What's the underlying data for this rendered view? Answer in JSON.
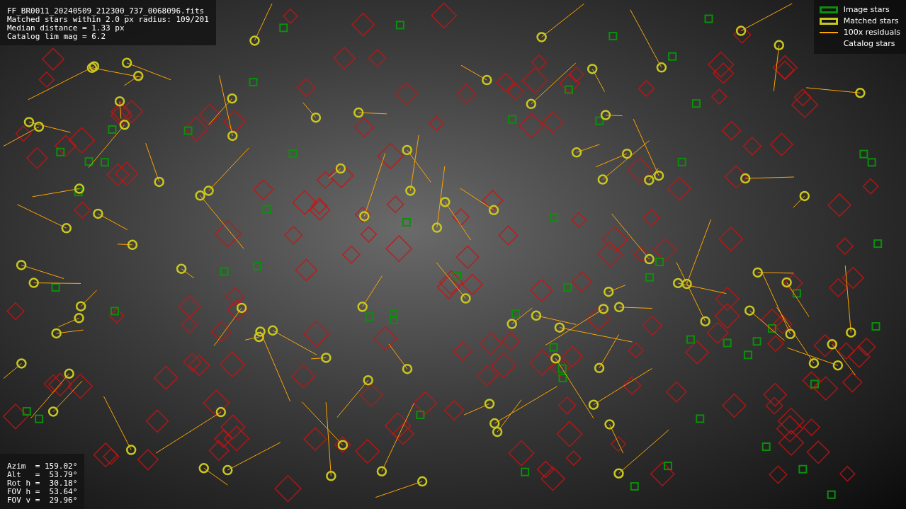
{
  "info_panel": {
    "lines": [
      "FF_BR0011_20240509_212300_737_0068096.fits",
      "Matched stars within 2.0 px radius: 109/201",
      "Median distance = 1.33 px",
      "Catalog lim mag = 6.2"
    ]
  },
  "legend": {
    "items": [
      {
        "label": "Image stars",
        "kind": "box",
        "color": "#0b8f0b"
      },
      {
        "label": "Matched stars",
        "kind": "box",
        "color": "#c8c81e"
      },
      {
        "label": "100x residuals",
        "kind": "line",
        "color": "#ffa500"
      },
      {
        "label": "Catalog stars",
        "kind": "none"
      }
    ]
  },
  "pointing_panel": {
    "lines": [
      "Azim  = 159.02°",
      "Alt   =  53.79°",
      "Rot h =  30.18°",
      "FOV h =  53.64°",
      "FOV v =  29.96°"
    ]
  }
}
